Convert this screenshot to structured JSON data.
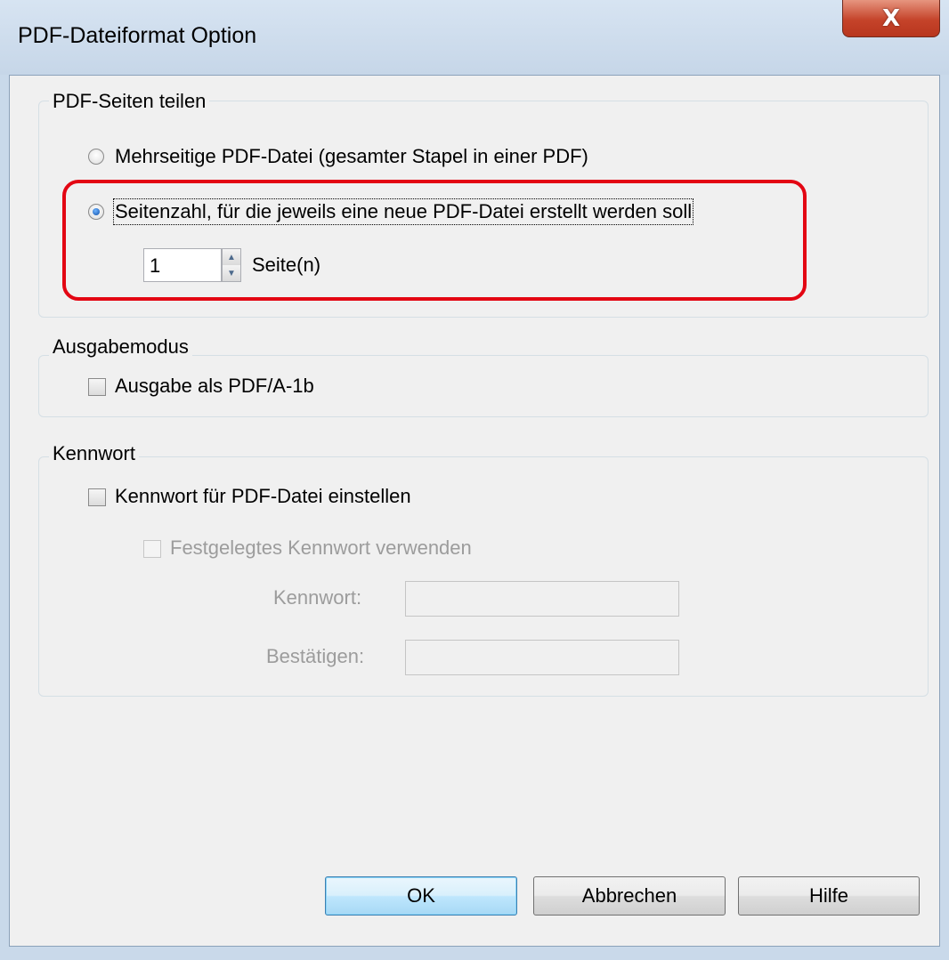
{
  "window": {
    "title": "PDF-Dateiformat Option",
    "close_label": "X"
  },
  "split_group": {
    "title": "PDF-Seiten teilen",
    "option_multi": "Mehrseitige PDF-Datei (gesamter Stapel in einer PDF)",
    "option_pages": "Seitenzahl, für die jeweils eine neue PDF-Datei erstellt werden soll",
    "selected": "option_pages",
    "pages_value": "1",
    "pages_unit": "Seite(n)"
  },
  "output_group": {
    "title": "Ausgabemodus",
    "pdfa_label": "Ausgabe als PDF/A-1b",
    "pdfa_checked": false
  },
  "password_group": {
    "title": "Kennwort",
    "set_password_label": "Kennwort für PDF-Datei einstellen",
    "set_password_checked": false,
    "fixed_password_label": "Festgelegtes Kennwort verwenden",
    "password_label": "Kennwort:",
    "confirm_label": "Bestätigen:"
  },
  "buttons": {
    "ok": "OK",
    "cancel": "Abbrechen",
    "help": "Hilfe"
  },
  "colors": {
    "highlight": "#e30613",
    "radio_selected": "#0f4fa8"
  }
}
